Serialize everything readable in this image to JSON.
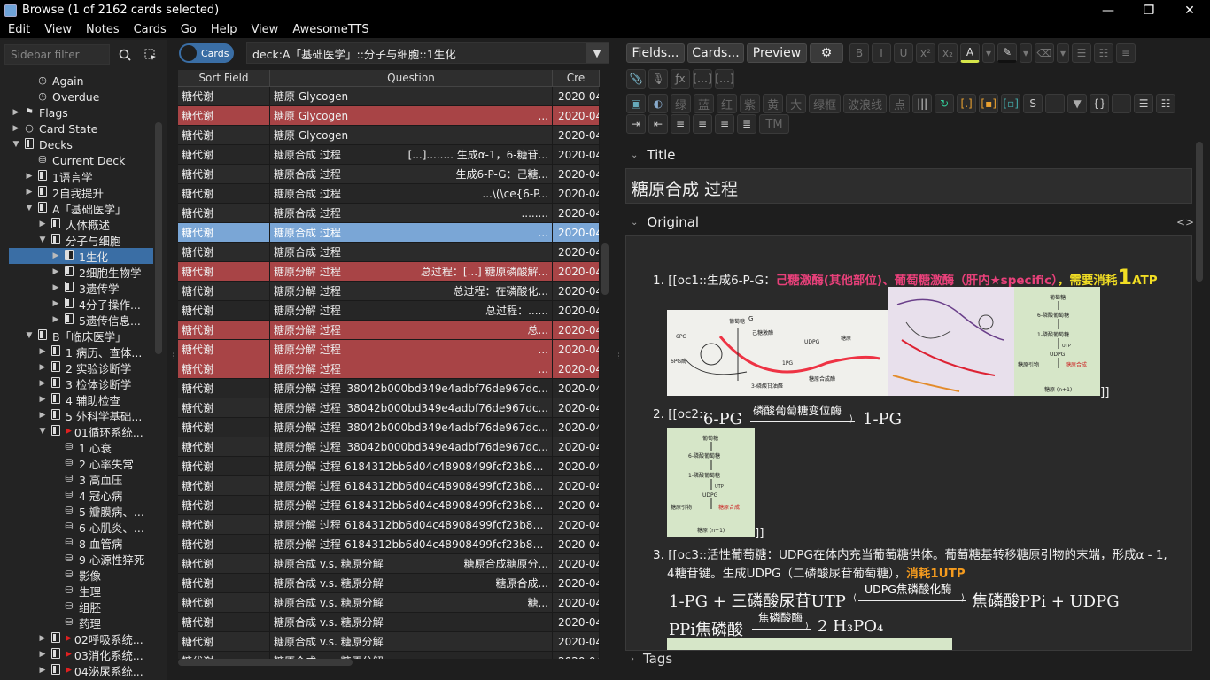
{
  "window": {
    "title": "Browse (1 of 2162 cards selected)"
  },
  "menu": [
    "Edit",
    "View",
    "Notes",
    "Cards",
    "Go",
    "Help",
    "View",
    "AwesomeTTS"
  ],
  "sidebar": {
    "filter_placeholder": "Sidebar filter",
    "items": [
      {
        "label": "Again",
        "icon": "clock-icon",
        "indent": 2,
        "arrow": ""
      },
      {
        "label": "Overdue",
        "icon": "clock-icon",
        "indent": 2,
        "arrow": ""
      },
      {
        "label": "Flags",
        "icon": "flag-icon",
        "indent": 1,
        "arrow": "▶"
      },
      {
        "label": "Card State",
        "icon": "circle-icon",
        "indent": 1,
        "arrow": "▶"
      },
      {
        "label": "Decks",
        "icon": "deck-icon",
        "indent": 1,
        "arrow": "▼"
      },
      {
        "label": "Current Deck",
        "icon": "deck-current-icon",
        "indent": 2,
        "arrow": ""
      },
      {
        "label": "1语言学",
        "icon": "deck-icon",
        "indent": 2,
        "arrow": "▶"
      },
      {
        "label": "2自我提升",
        "icon": "deck-icon",
        "indent": 2,
        "arrow": "▶"
      },
      {
        "label": "A「基础医学」",
        "icon": "deck-icon",
        "indent": 2,
        "arrow": "▼"
      },
      {
        "label": "人体概述",
        "icon": "deck-icon",
        "indent": 3,
        "arrow": "▶"
      },
      {
        "label": "分子与细胞",
        "icon": "deck-icon",
        "indent": 3,
        "arrow": "▼"
      },
      {
        "label": "1生化",
        "icon": "deck-icon",
        "indent": 4,
        "arrow": "▶",
        "selected": true
      },
      {
        "label": "2细胞生物学",
        "icon": "deck-icon",
        "indent": 4,
        "arrow": "▶"
      },
      {
        "label": "3遗传学",
        "icon": "deck-icon",
        "indent": 4,
        "arrow": "▶"
      },
      {
        "label": "4分子操作...",
        "icon": "deck-icon",
        "indent": 4,
        "arrow": "▶"
      },
      {
        "label": "5遗传信息...",
        "icon": "deck-icon",
        "indent": 4,
        "arrow": "▶"
      },
      {
        "label": "B「临床医学」",
        "icon": "deck-icon",
        "indent": 2,
        "arrow": "▼"
      },
      {
        "label": "1 病历、查体...",
        "icon": "deck-icon",
        "indent": 3,
        "arrow": "▶"
      },
      {
        "label": "2 实验诊断学",
        "icon": "deck-icon",
        "indent": 3,
        "arrow": "▶"
      },
      {
        "label": "3 检体诊断学",
        "icon": "deck-icon",
        "indent": 3,
        "arrow": "▶"
      },
      {
        "label": "4 辅助检查",
        "icon": "deck-icon",
        "indent": 3,
        "arrow": "▶"
      },
      {
        "label": "5 外科学基础...",
        "icon": "deck-icon",
        "indent": 3,
        "arrow": "▶"
      },
      {
        "label": "01循环系统...",
        "icon": "deck-icon",
        "indent": 3,
        "arrow": "▼",
        "flag": true
      },
      {
        "label": "1 心衰",
        "icon": "deck-filtered-icon",
        "indent": 4,
        "arrow": ""
      },
      {
        "label": "2 心率失常",
        "icon": "deck-filtered-icon",
        "indent": 4,
        "arrow": ""
      },
      {
        "label": "3 高血压",
        "icon": "deck-filtered-icon",
        "indent": 4,
        "arrow": ""
      },
      {
        "label": "4 冠心病",
        "icon": "deck-filtered-icon",
        "indent": 4,
        "arrow": ""
      },
      {
        "label": "5 瓣膜病、...",
        "icon": "deck-filtered-icon",
        "indent": 4,
        "arrow": ""
      },
      {
        "label": "6 心肌炎、...",
        "icon": "deck-filtered-icon",
        "indent": 4,
        "arrow": ""
      },
      {
        "label": "8 血管病",
        "icon": "deck-filtered-icon",
        "indent": 4,
        "arrow": ""
      },
      {
        "label": "9 心源性猝死",
        "icon": "deck-filtered-icon",
        "indent": 4,
        "arrow": ""
      },
      {
        "label": "影像",
        "icon": "deck-filtered-icon",
        "indent": 4,
        "arrow": ""
      },
      {
        "label": "生理",
        "icon": "deck-filtered-icon",
        "indent": 4,
        "arrow": ""
      },
      {
        "label": "组胚",
        "icon": "deck-filtered-icon",
        "indent": 4,
        "arrow": ""
      },
      {
        "label": "药理",
        "icon": "deck-filtered-icon",
        "indent": 4,
        "arrow": ""
      },
      {
        "label": "02呼吸系统...",
        "icon": "deck-icon",
        "indent": 3,
        "arrow": "▶",
        "flag": true
      },
      {
        "label": "03消化系统...",
        "icon": "deck-icon",
        "indent": 3,
        "arrow": "▶",
        "flag": true
      },
      {
        "label": "04泌尿系统...",
        "icon": "deck-icon",
        "indent": 3,
        "arrow": "▶",
        "flag": true
      }
    ]
  },
  "search": {
    "toggle_label": "Cards",
    "query": "deck:A「基础医学」::分子与细胞::1生化"
  },
  "table": {
    "columns": [
      "Sort Field",
      "Question",
      "Cre"
    ],
    "rows": [
      {
        "sort": "糖代谢",
        "q1": "糖原 Glycogen",
        "q2": "",
        "created": "2020-04",
        "state": "odd"
      },
      {
        "sort": "糖代谢",
        "q1": "糖原 Glycogen",
        "q2": "...",
        "created": "2020-04",
        "state": "red"
      },
      {
        "sort": "糖代谢",
        "q1": "糖原 Glycogen",
        "q2": "",
        "created": "2020-04",
        "state": "odd"
      },
      {
        "sort": "糖代谢",
        "q1": "糖原合成 过程",
        "q2": "[...]........ 生成α-1，6-糖苷...",
        "created": "2020-04",
        "state": "even"
      },
      {
        "sort": "糖代谢",
        "q1": "糖原合成 过程",
        "q2": "生成6-P-G：己糖...",
        "created": "2020-04",
        "state": "odd"
      },
      {
        "sort": "糖代谢",
        "q1": "糖原合成 过程",
        "q2": "...\\(\\ce{6-P...",
        "created": "2020-04",
        "state": "even"
      },
      {
        "sort": "糖代谢",
        "q1": "糖原合成 过程",
        "q2": "........",
        "created": "2020-04",
        "state": "odd"
      },
      {
        "sort": "糖代谢",
        "q1": "糖原合成 过程",
        "q2": "...",
        "created": "2020-04",
        "state": "blue"
      },
      {
        "sort": "糖代谢",
        "q1": "糖原合成 过程",
        "q2": "",
        "created": "2020-04",
        "state": "odd"
      },
      {
        "sort": "糖代谢",
        "q1": "糖原分解 过程",
        "q2": "总过程：[...] 糖原磷酸解...",
        "created": "2020-04",
        "state": "red"
      },
      {
        "sort": "糖代谢",
        "q1": "糖原分解 过程",
        "q2": "总过程：在磷酸化...",
        "created": "2020-04",
        "state": "odd"
      },
      {
        "sort": "糖代谢",
        "q1": "糖原分解 过程",
        "q2": "总过程：......",
        "created": "2020-04",
        "state": "even"
      },
      {
        "sort": "糖代谢",
        "q1": "糖原分解 过程",
        "q2": "总...",
        "created": "2020-04",
        "state": "red"
      },
      {
        "sort": "糖代谢",
        "q1": "糖原分解 过程",
        "q2": "...",
        "created": "2020-04",
        "state": "red"
      },
      {
        "sort": "糖代谢",
        "q1": "糖原分解 过程",
        "q2": "...",
        "created": "2020-04",
        "state": "red"
      },
      {
        "sort": "糖代谢",
        "q1": "糖原分解 过程",
        "q2": "38042b000bd349e4adbf76de967dc...",
        "created": "2020-04",
        "state": "even"
      },
      {
        "sort": "糖代谢",
        "q1": "糖原分解 过程",
        "q2": "38042b000bd349e4adbf76de967dc...",
        "created": "2020-04",
        "state": "odd"
      },
      {
        "sort": "糖代谢",
        "q1": "糖原分解 过程",
        "q2": "38042b000bd349e4adbf76de967dc...",
        "created": "2020-04",
        "state": "even"
      },
      {
        "sort": "糖代谢",
        "q1": "糖原分解 过程",
        "q2": "38042b000bd349e4adbf76de967dc...",
        "created": "2020-04",
        "state": "odd"
      },
      {
        "sort": "糖代谢",
        "q1": "糖原分解 过程",
        "q2": "6184312bb6d04c48908499fcf23b879...",
        "created": "2020-04",
        "state": "even"
      },
      {
        "sort": "糖代谢",
        "q1": "糖原分解 过程",
        "q2": "6184312bb6d04c48908499fcf23b879...",
        "created": "2020-04",
        "state": "odd"
      },
      {
        "sort": "糖代谢",
        "q1": "糖原分解 过程",
        "q2": "6184312bb6d04c48908499fcf23b879...",
        "created": "2020-04",
        "state": "even"
      },
      {
        "sort": "糖代谢",
        "q1": "糖原分解 过程",
        "q2": "6184312bb6d04c48908499fcf23b879...",
        "created": "2020-04",
        "state": "odd"
      },
      {
        "sort": "糖代谢",
        "q1": "糖原分解 过程",
        "q2": "6184312bb6d04c48908499fcf23b879...",
        "created": "2020-04",
        "state": "even"
      },
      {
        "sort": "糖代谢",
        "q1": "糖原合成 v.s. 糖原分解",
        "q2": "糖原合成糖原分...",
        "created": "2020-04",
        "state": "odd"
      },
      {
        "sort": "糖代谢",
        "q1": "糖原合成 v.s. 糖原分解",
        "q2": "糖原合成...",
        "created": "2020-04",
        "state": "even"
      },
      {
        "sort": "糖代谢",
        "q1": "糖原合成 v.s. 糖原分解",
        "q2": "糖...",
        "created": "2020-04",
        "state": "odd"
      },
      {
        "sort": "糖代谢",
        "q1": "糖原合成 v.s. 糖原分解",
        "q2": "",
        "created": "2020-04",
        "state": "even"
      },
      {
        "sort": "糖代谢",
        "q1": "糖原合成 v.s. 糖原分解",
        "q2": "",
        "created": "2020-04",
        "state": "odd"
      },
      {
        "sort": "糖代谢",
        "q1": "糖原合成 v.s. 糖原分解",
        "q2": "",
        "created": "2020-04",
        "state": "even"
      }
    ]
  },
  "editor": {
    "fields_button": "Fields...",
    "cards_button": "Cards...",
    "preview_button": "Preview",
    "format_buttons": [
      "B",
      "I",
      "U",
      "x²",
      "x₂",
      "A"
    ],
    "style_buttons_row1": [
      "绿",
      "蓝",
      "红",
      "紫",
      "黄",
      "大",
      "绿框",
      "波浪线",
      "点"
    ],
    "tm_label": "TM",
    "title_label": "Title",
    "title_value": "糖原合成 过程",
    "original_label": "Original",
    "tags_label": "Tags",
    "list": {
      "n1": "1.",
      "item1_prefix": "[[oc1::生成6-P-G：",
      "item1_pink": "己糖激酶(其他部位)、葡萄糖激酶（肝内★specific）",
      "item1_sep": "，",
      "item1_yellow": "需要消耗",
      "item1_big": "1",
      "item1_atp": "ATP",
      "item1_close": "]]",
      "n2": "2.",
      "item2_prefix": "[[oc2::",
      "item2_left": "6-PG",
      "item2_enzyme": "磷酸葡萄糖变位酶",
      "item2_right": "1-PG",
      "item2_close": "]]",
      "n3": "3.",
      "item3_line1": "[[oc3::活性葡萄糖：UDPG在体内充当葡萄糖供体。葡萄糖基转移糖原引物的末端，形成α - 1,",
      "item3_line2a": "4糖苷键。生成UDPG（二磷酸尿苷葡萄糖），",
      "item3_orange": "消耗1UTP",
      "eq1_left": "1-PG + 三磷酸尿苷UTP",
      "eq1_enzyme": "UDPG焦磷酸化酶",
      "eq1_right": "焦磷酸PPi + UDPG",
      "eq2_left": "PPi焦磷酸",
      "eq2_enzyme": "焦磷酸酶",
      "eq2_right": "2 H₃PO₄"
    },
    "images": {
      "img1_labels": [
        "葡萄糖",
        "G",
        "己糖激酶",
        "6PG",
        "1PG",
        "UDPG",
        "糖原",
        "6PG酶",
        "3-磷酸甘油醛",
        "糖原合成酶"
      ],
      "green_labels": [
        "葡萄糖",
        "6-磷酸葡萄糖",
        "1-磷酸葡萄糖",
        "UTP",
        "UDPG",
        "糖原引物",
        "糖原合成",
        "糖原 (n+1)"
      ]
    }
  },
  "colors": {
    "red_row": "#a84446",
    "blue_row": "#7aa6d6",
    "selected": "#3a6ea5",
    "pink": "#e8407a",
    "yellow": "#f1dd24",
    "orange": "#f59b1e"
  }
}
